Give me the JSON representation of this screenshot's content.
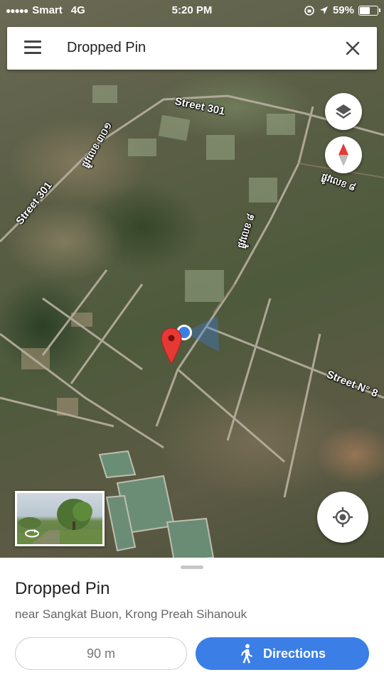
{
  "status_bar": {
    "signal": "●●●●●",
    "carrier": "Smart",
    "network": "4G",
    "time": "5:20 PM",
    "battery": "59%",
    "icons": [
      "screen-rotation-lock-icon",
      "location-arrow-icon",
      "battery-icon"
    ]
  },
  "search": {
    "title": "Dropped Pin",
    "menu_icon": "hamburger-menu-icon",
    "close_icon": "close-icon"
  },
  "map": {
    "view": "satellite",
    "street_labels": {
      "street_301_top": "Street 301",
      "street_301_left": "Street 301",
      "street_n8": "Street N° 8",
      "khmer_1": "ផ្លូវលេខ ៣០១",
      "khmer_2": "ផ្លូវលេខ ៨",
      "khmer_3": "ផ្លូវលេខ ៨"
    },
    "controls": {
      "layers_icon": "layers-icon",
      "compass_icon": "compass-icon",
      "my_location_icon": "my-location-icon"
    },
    "markers": {
      "pin_color": "#e53935",
      "current_location_color": "#3b7ee6"
    }
  },
  "street_view": {
    "icon": "360-rotate-icon"
  },
  "sheet": {
    "title": "Dropped Pin",
    "subtitle": "near Sangkat Buon, Krong Preah Sihanouk",
    "distance_label": "90 m",
    "directions_label": "Directions",
    "directions_icon": "walking-person-icon",
    "accent_color": "#3b7ee6"
  }
}
